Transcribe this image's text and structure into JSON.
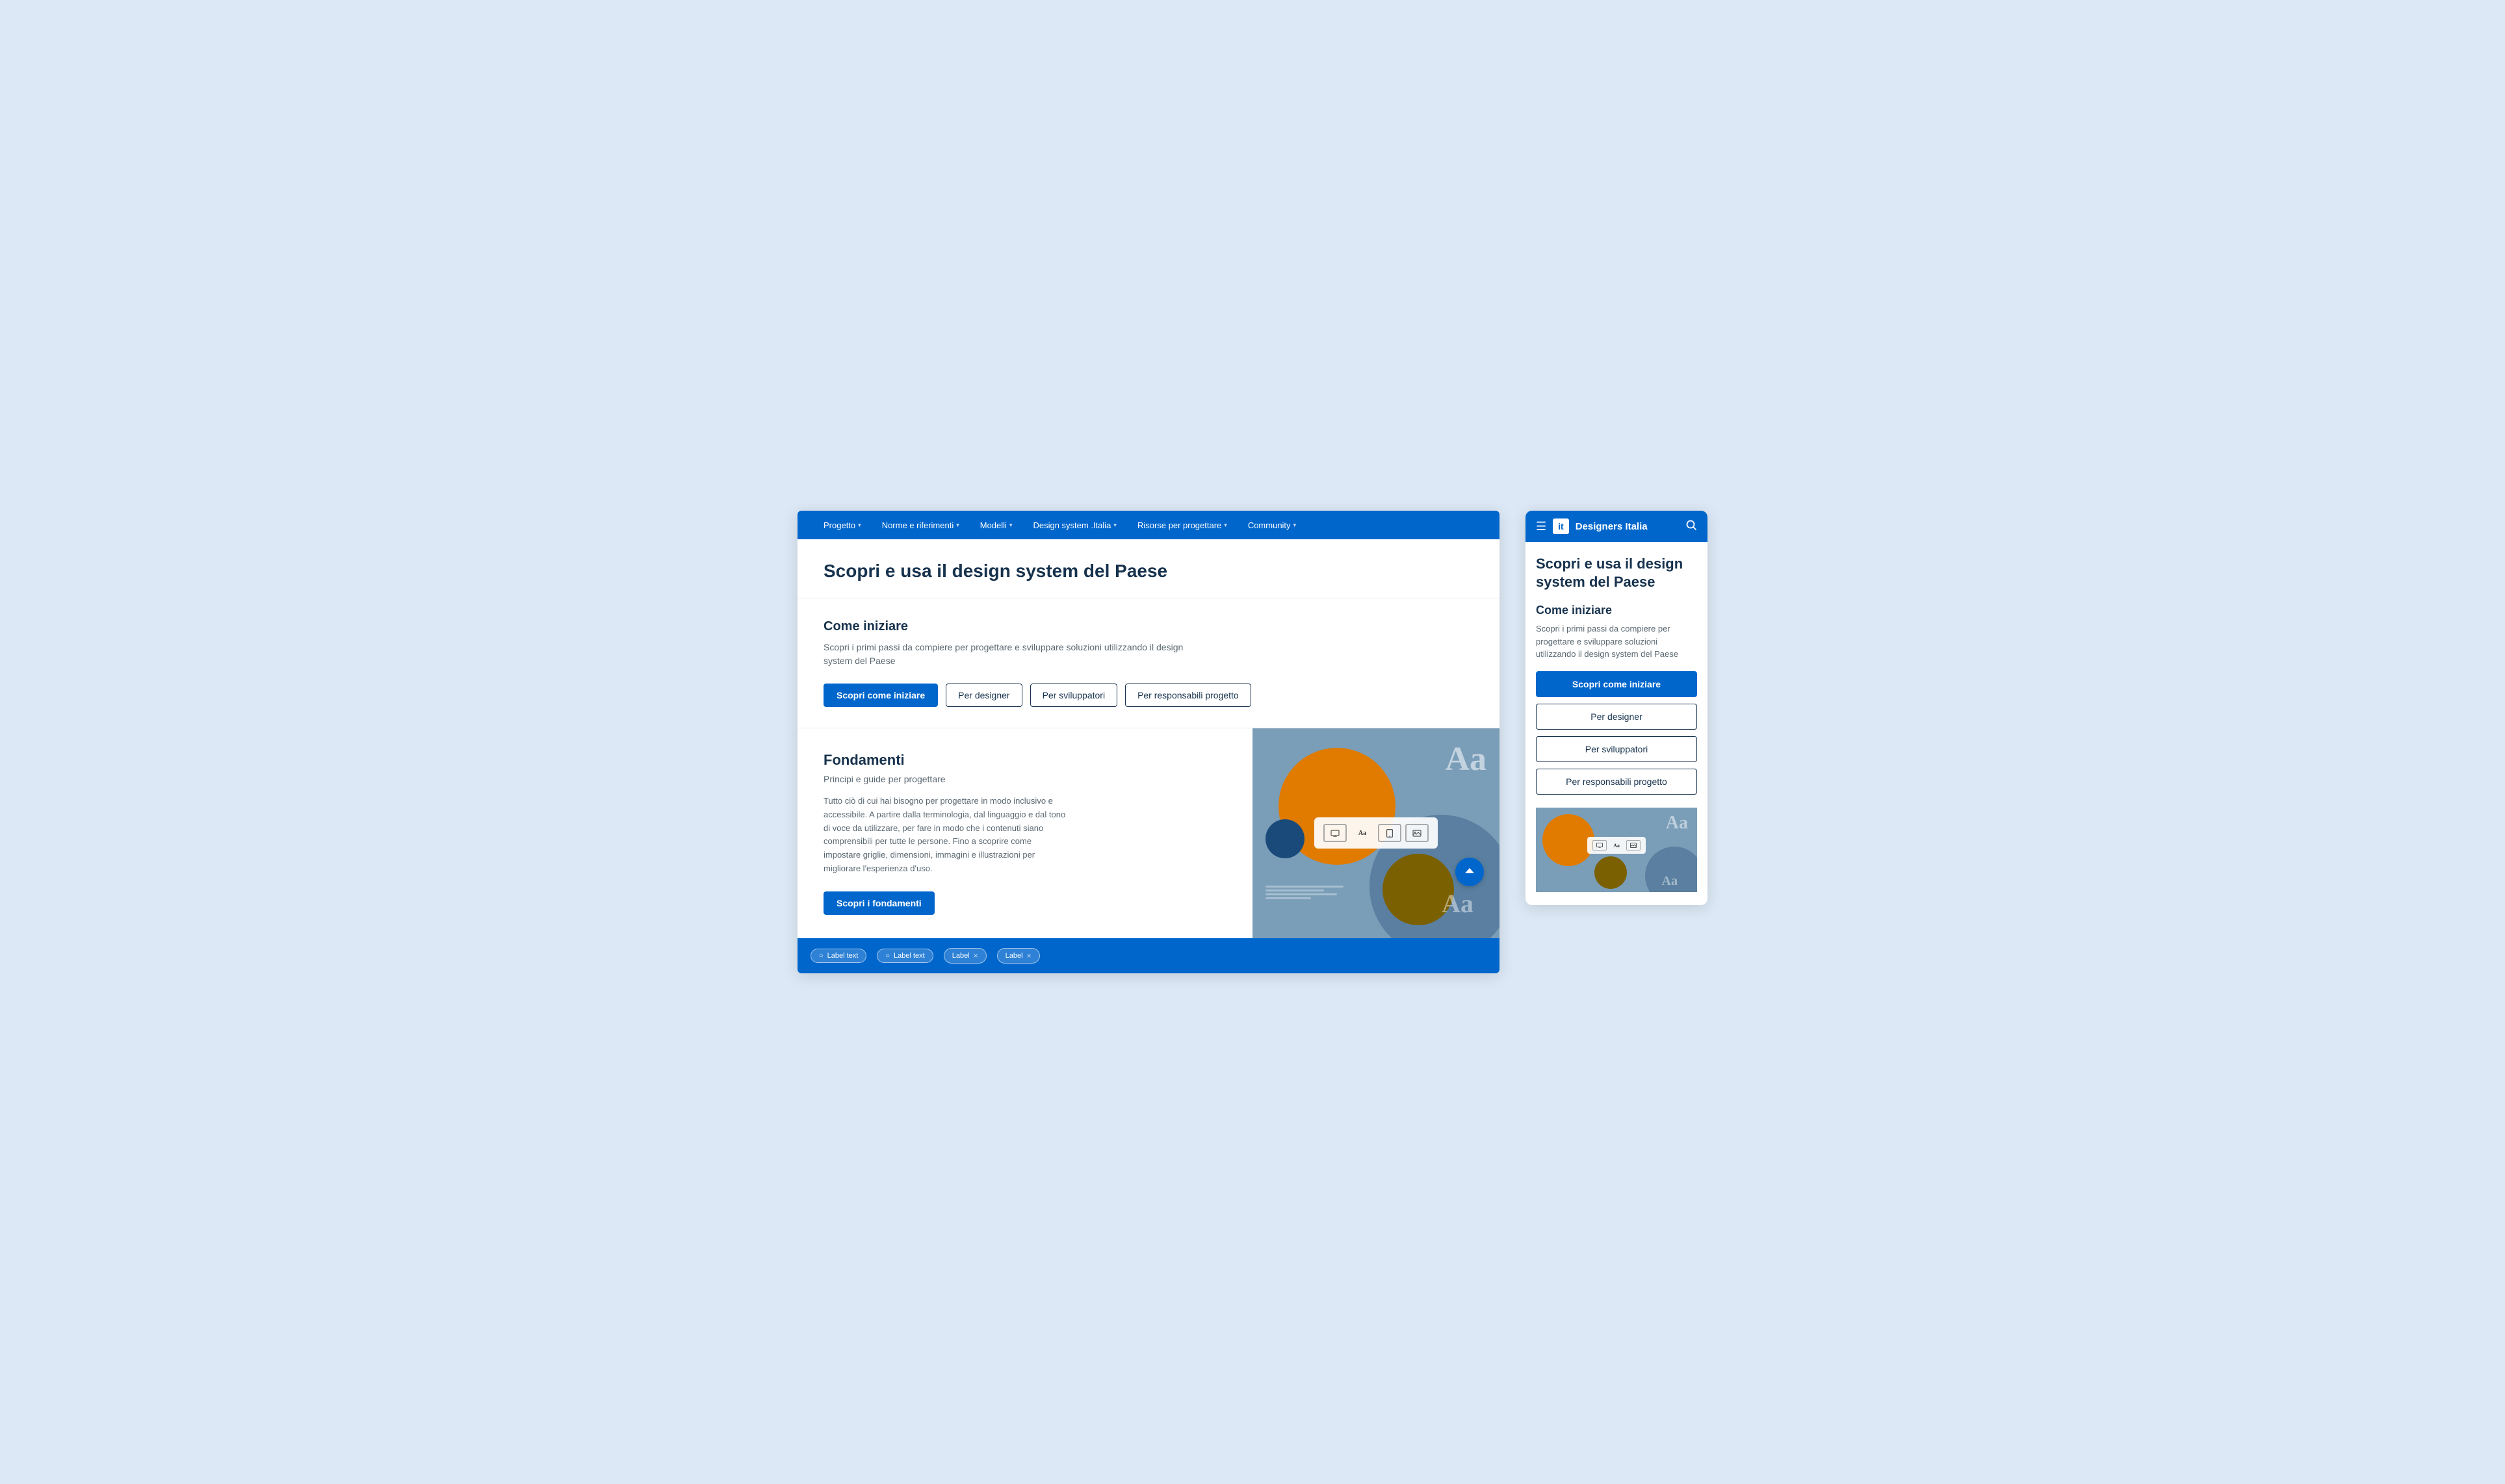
{
  "browser": {
    "navbar": {
      "items": [
        {
          "label": "Progetto",
          "hasChevron": true
        },
        {
          "label": "Norme e riferimenti",
          "hasChevron": true
        },
        {
          "label": "Modelli",
          "hasChevron": true
        },
        {
          "label": "Design system .Italia",
          "hasChevron": true
        },
        {
          "label": "Risorse per progettare",
          "hasChevron": true
        },
        {
          "label": "Community",
          "hasChevron": true
        }
      ]
    },
    "hero": {
      "title": "Scopri e usa il design system del Paese"
    },
    "come_iniziare": {
      "title": "Come iniziare",
      "description": "Scopri i primi passi da compiere per progettare e sviluppare soluzioni utilizzando il design system del Paese",
      "buttons": [
        {
          "label": "Scopri come iniziare",
          "type": "primary"
        },
        {
          "label": "Per designer",
          "type": "outline"
        },
        {
          "label": "Per sviluppatori",
          "type": "outline"
        },
        {
          "label": "Per responsabili progetto",
          "type": "outline"
        }
      ]
    },
    "fondamenti": {
      "title": "Fondamenti",
      "subtitle": "Principi e guide per progettare",
      "body": "Tutto ciò di cui hai bisogno per progettare in modo inclusivo e accessibile. A partire dalla terminologia, dal linguaggio e dal tono di voce da utilizzare, per fare in modo che i contenuti siano comprensibili per tutte le persone. Fino a scoprire come impostare griglie, dimensioni, immagini e illustrazioni per migliorare l'esperienza d'uso.",
      "button_label": "Scopri i fondamenti"
    },
    "bottom_chips": [
      {
        "label": "Label text",
        "hasClose": false,
        "hasIcon": true
      },
      {
        "label": "Label text",
        "hasClose": false,
        "hasIcon": true
      },
      {
        "label": "Label",
        "hasClose": true
      },
      {
        "label": "Label",
        "hasClose": true
      }
    ]
  },
  "mobile": {
    "header": {
      "logo_text": "it",
      "brand": "Designers Italia",
      "hamburger_icon": "☰",
      "search_icon": "🔍"
    },
    "hero": {
      "title": "Scopri e usa il design system del Paese"
    },
    "come_iniziare": {
      "title": "Come iniziare",
      "description": "Scopri i primi passi da compiere per progettare e sviluppare soluzioni utilizzando il design system del Paese",
      "buttons": [
        {
          "label": "Scopri come iniziare",
          "type": "primary"
        },
        {
          "label": "Per designer",
          "type": "outline"
        },
        {
          "label": "Per sviluppatori",
          "type": "outline"
        },
        {
          "label": "Per responsabili progetto",
          "type": "outline"
        }
      ]
    }
  },
  "colors": {
    "primary": "#0066CC",
    "text_dark": "#17324d",
    "text_light": "#5a6872",
    "bg_light": "#dce8f5",
    "orange": "#e07b00"
  }
}
